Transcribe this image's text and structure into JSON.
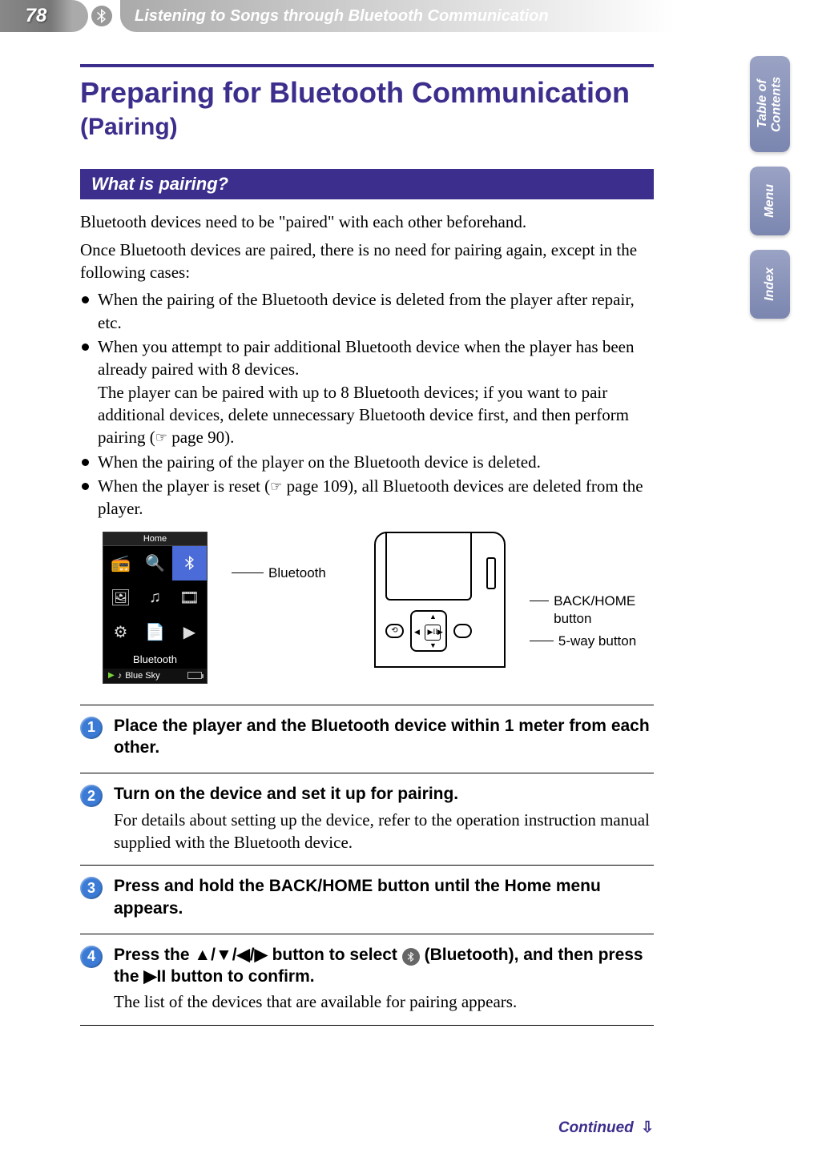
{
  "header": {
    "page_number": "78",
    "chapter_title": "Listening to Songs through Bluetooth Communication"
  },
  "title": {
    "main": "Preparing for Bluetooth Communication ",
    "sub": "(Pairing)"
  },
  "section_heading": "What is pairing?",
  "intro_p1": "Bluetooth devices need to be \"paired\" with each other beforehand.",
  "intro_p2": "Once Bluetooth devices are paired, there is no need for pairing again, except in the following cases:",
  "bullets": {
    "b1": "When the pairing of the Bluetooth device is deleted from the player after repair, etc.",
    "b2a": "When you attempt to pair additional Bluetooth device when the player has been already paired with 8 devices.",
    "b2b_pre": "The player can be paired with up to 8 Bluetooth devices; if you want to pair additional devices, delete unnecessary Bluetooth device first, and then perform pairing (",
    "b2b_ref": " page 90",
    "b2b_post": ").",
    "b3": "When the pairing of the player on the Bluetooth device is deleted.",
    "b4_pre": "When the player is reset (",
    "b4_ref": " page 109",
    "b4_post": "), all Bluetooth devices are deleted from the player."
  },
  "figure": {
    "home_title": "Home",
    "home_menu_label": "Bluetooth",
    "now_playing": "Blue Sky",
    "callout_bluetooth": "Bluetooth",
    "callout_backhome": "BACK/HOME button",
    "callout_5way": "5-way button"
  },
  "steps": [
    {
      "num": "1",
      "heading": "Place the player and the Bluetooth device within 1 meter from each other.",
      "text": ""
    },
    {
      "num": "2",
      "heading": "Turn on the device and set it up for pairing.",
      "text": "For details about setting up the device, refer to the operation instruction manual supplied with the Bluetooth device."
    },
    {
      "num": "3",
      "heading": "Press and hold the BACK/HOME button until the Home menu appears.",
      "text": ""
    },
    {
      "num": "4",
      "heading_pre": "Press the ▲/▼/◀/▶ button to select ",
      "heading_post": " (Bluetooth), and then press the ▶II button to confirm.",
      "text": "The list of the devices that are available for pairing appears."
    }
  ],
  "continued": "Continued",
  "tabs": {
    "toc": "Table of Contents",
    "menu": "Menu",
    "index": "Index"
  }
}
